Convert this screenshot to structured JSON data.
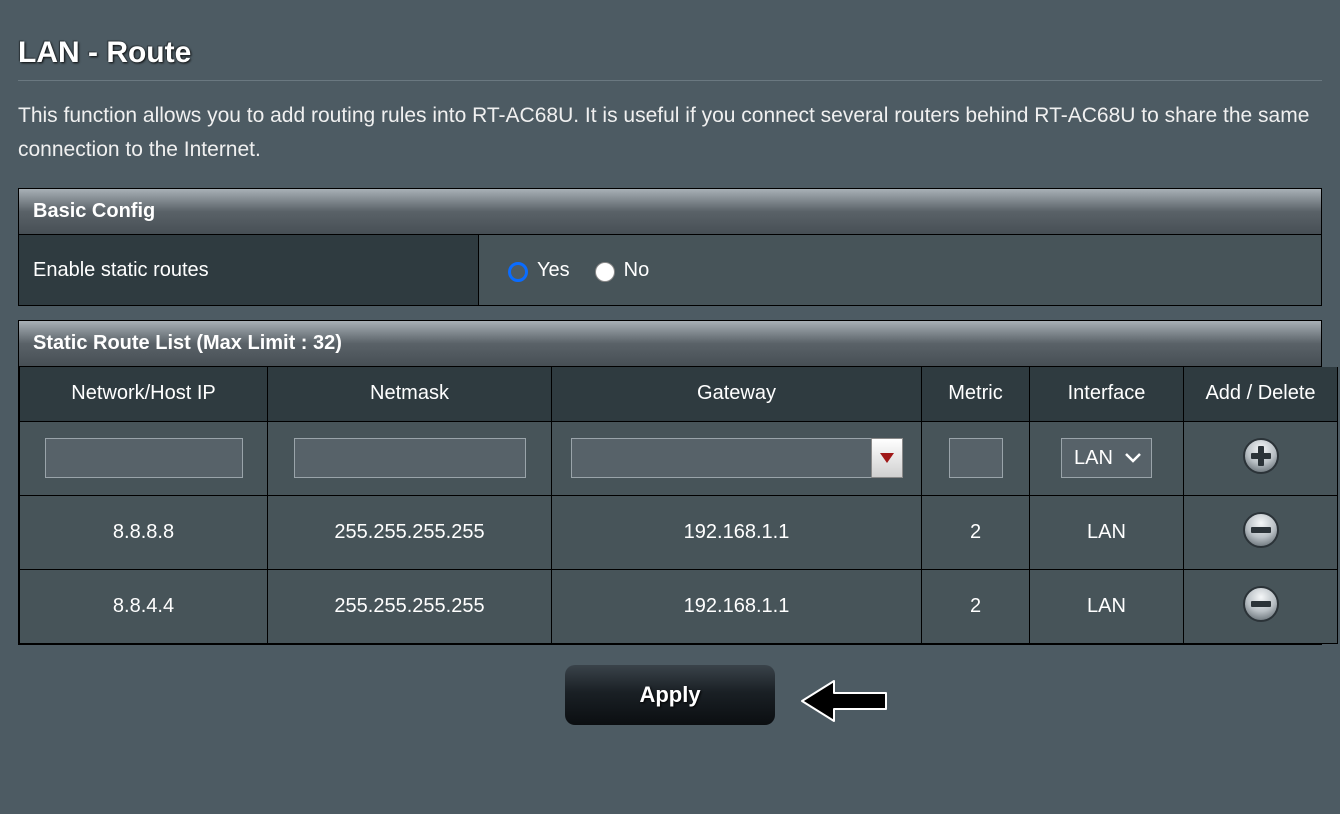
{
  "page": {
    "title": "LAN - Route",
    "description": "This function allows you to add routing rules into RT-AC68U. It is useful if you connect several routers behind RT-AC68U to share the same connection to the Internet."
  },
  "basic_config": {
    "header": "Basic Config",
    "enable_static_label": "Enable static routes",
    "yes_label": "Yes",
    "no_label": "No",
    "selected": "yes"
  },
  "route_list": {
    "header": "Static Route List (Max Limit : 32)",
    "columns": {
      "ip": "Network/Host IP",
      "netmask": "Netmask",
      "gateway": "Gateway",
      "metric": "Metric",
      "interface": "Interface",
      "action": "Add / Delete"
    },
    "input_row": {
      "ip": "",
      "netmask": "",
      "gateway": "",
      "metric": "",
      "interface_selected": "LAN"
    },
    "rows": [
      {
        "ip": "8.8.8.8",
        "netmask": "255.255.255.255",
        "gateway": "192.168.1.1",
        "metric": "2",
        "interface": "LAN"
      },
      {
        "ip": "8.8.4.4",
        "netmask": "255.255.255.255",
        "gateway": "192.168.1.1",
        "metric": "2",
        "interface": "LAN"
      }
    ]
  },
  "apply_label": "Apply"
}
